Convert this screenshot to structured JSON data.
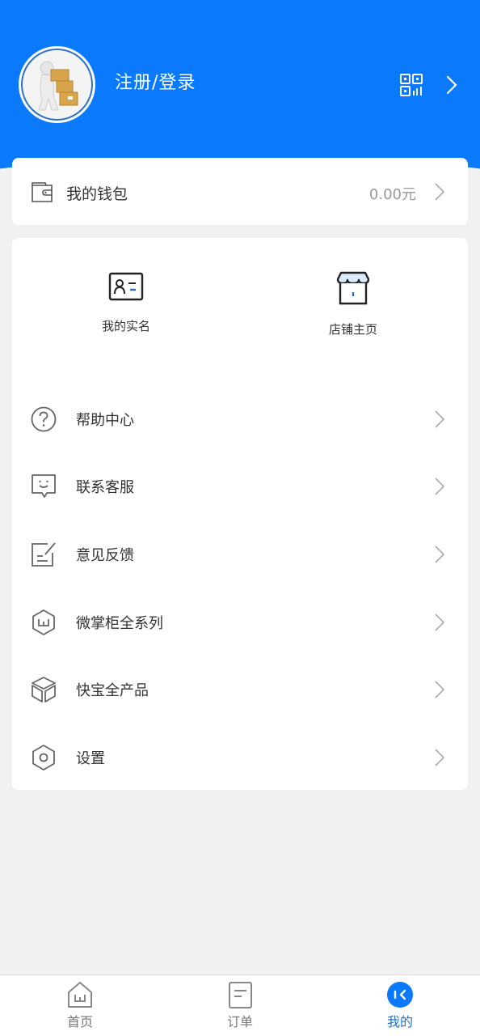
{
  "header": {
    "login_label": "注册/登录",
    "background_color": "#0a79fb",
    "icons": [
      "avatar-image",
      "qr-code-icon",
      "chevron-right-icon"
    ]
  },
  "wallet": {
    "label": "我的钱包",
    "value": "0.00元",
    "icon": "wallet-icon"
  },
  "quick_grid": [
    {
      "label": "我的实名",
      "icon": "id-card-icon"
    },
    {
      "label": "店铺主页",
      "icon": "storefront-icon"
    }
  ],
  "menu": [
    {
      "label": "帮助中心",
      "icon": "help-circle-icon"
    },
    {
      "label": "联系客服",
      "icon": "chat-smile-icon"
    },
    {
      "label": "意见反馈",
      "icon": "feedback-edit-icon"
    },
    {
      "label": "微掌柜全系列",
      "icon": "hexagon-w-icon"
    },
    {
      "label": "快宝全产品",
      "icon": "cube-icon"
    },
    {
      "label": "设置",
      "icon": "settings-hexagon-icon"
    }
  ],
  "tabbar": {
    "items": [
      {
        "label": "首页",
        "icon": "home-icon",
        "active": false
      },
      {
        "label": "订单",
        "icon": "order-doc-icon",
        "active": false
      },
      {
        "label": "我的",
        "icon": "profile-icon",
        "active": true
      }
    ],
    "active_color": "#1a73d9"
  }
}
